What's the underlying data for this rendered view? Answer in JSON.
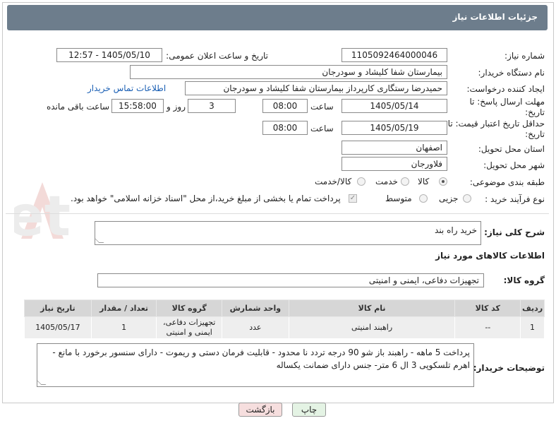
{
  "header": {
    "title": "جزئیات اطلاعات نیاز"
  },
  "fields": {
    "need_number_label": "شماره نیاز:",
    "need_number": "1105092464000046",
    "announce_label": "تاریخ و ساعت اعلان عمومی:",
    "announce_value": "1405/05/10 - 12:57",
    "buyer_org_label": "نام دستگاه خریدار:",
    "buyer_org": "بیمارستان شفا کلیشاد و سودرجان",
    "creator_label": "ایجاد کننده درخواست:",
    "creator": "حمیدرضا رستگاری کارپرداز بیمارستان شفا کلیشاد و سودرجان",
    "contact_link": "اطلاعات تماس خریدار",
    "deadline_label": "مهلت ارسال پاسخ: تا تاریخ:",
    "deadline_date": "1405/05/14",
    "time_label": "ساعت",
    "deadline_time": "08:00",
    "days_value": "3",
    "days_label": "روز و",
    "remaining_time": "15:58:00",
    "remaining_label": "ساعت باقی مانده",
    "price_validity_label": "حداقل تاریخ اعتبار قیمت: تا تاریخ:",
    "price_validity_date": "1405/05/19",
    "price_validity_time": "08:00",
    "province_label": "استان محل تحویل:",
    "province": "اصفهان",
    "city_label": "شهر محل تحویل:",
    "city": "فلاورجان",
    "category_label": "طبقه بندی موضوعی:",
    "category_options": [
      "کالا",
      "خدمت",
      "کالا/خدمت"
    ],
    "process_label": "نوع فرآیند خرید :",
    "process_options": [
      "جزیی",
      "متوسط"
    ],
    "payment_note": "پرداخت تمام یا بخشی از مبلغ خرید،از محل \"اسناد خزانه اسلامی\" خواهد بود."
  },
  "description": {
    "label": "شرح کلی نیاز:",
    "value": "خرید راه بند"
  },
  "goods_section": {
    "title": "اطلاعات کالاهای مورد نیاز",
    "group_label": "گروه کالا:",
    "group_value": "تجهیزات دفاعی، ایمنی و امنیتی"
  },
  "table": {
    "headers": [
      "ردیف",
      "کد کالا",
      "نام کالا",
      "واحد شمارش",
      "گروه کالا",
      "تعداد / مقدار",
      "تاریخ نیاز"
    ],
    "rows": [
      [
        "1",
        "--",
        "راهبند امنیتی",
        "عدد",
        "تجهیزات دفاعی، ایمنی و امنیتی",
        "1",
        "1405/05/17"
      ]
    ]
  },
  "buyer_notes": {
    "label": "توضیحات خریدار:",
    "value": "پرداخت 5 ماهه - راهبند باز شو 90 درجه تردد نا محدود - قابلیت فرمان دستی و ریموت - دارای سنسور برخورد با مانع - اهرم تلسکوپی 3 ال 6 متر- جنس دارای ضمانت یکساله"
  },
  "buttons": {
    "print": "چاپ",
    "back": "بازگشت"
  },
  "watermark": "AriaTender.net",
  "colors": {
    "header": "#6d7d8c",
    "link": "#1a5fb4",
    "print_btn": "#e4f3e4",
    "back_btn": "#f6dede"
  }
}
